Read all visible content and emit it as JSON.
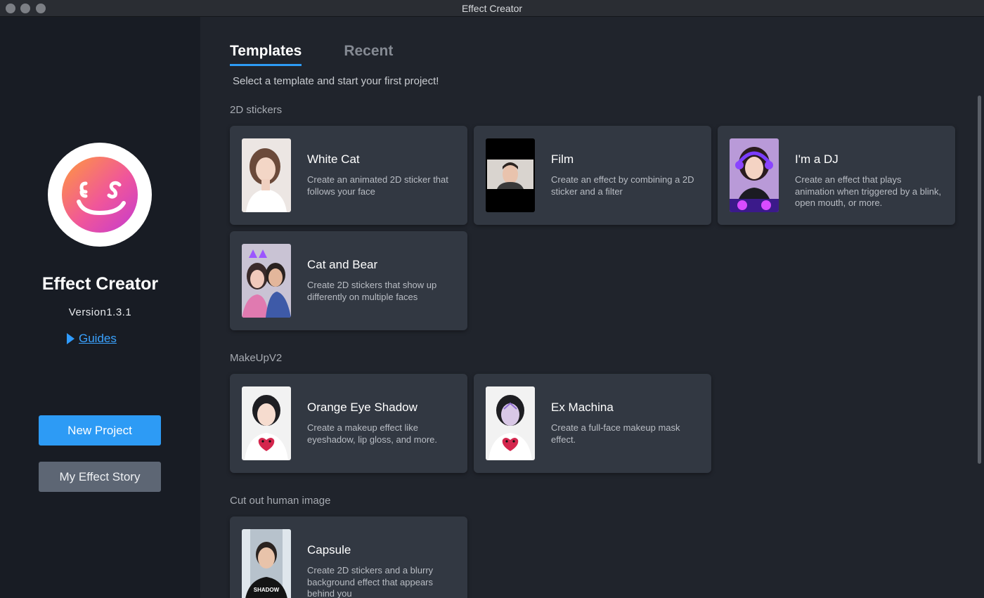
{
  "window": {
    "title": "Effect Creator"
  },
  "sidebar": {
    "app_name": "Effect Creator",
    "version": "Version1.3.1",
    "guides_label": "Guides",
    "new_project_label": "New Project",
    "story_label": "My Effect Story"
  },
  "main": {
    "tabs": [
      {
        "label": "Templates",
        "active": true
      },
      {
        "label": "Recent",
        "active": false
      }
    ],
    "subtitle": "Select a template and start your first project!",
    "sections": [
      {
        "title": "2D stickers"
      },
      {
        "title": "MakeUpV2"
      },
      {
        "title": "Cut out human image"
      }
    ],
    "cards": [
      {
        "title": "White Cat",
        "desc": "Create an animated 2D sticker that follows your face"
      },
      {
        "title": "Film",
        "desc": "Create an effect by combining a 2D sticker and a filter"
      },
      {
        "title": "I'm a DJ",
        "desc": "Create an effect that plays animation when triggered by a blink, open mouth, or more."
      },
      {
        "title": "Cat and Bear",
        "desc": "Create 2D stickers that show up differently on multiple faces"
      },
      {
        "title": "Orange Eye Shadow",
        "desc": "Create a makeup effect like eyeshadow, lip gloss, and more."
      },
      {
        "title": "Ex Machina",
        "desc": "Create a full-face makeup mask effect."
      },
      {
        "title": "Capsule",
        "desc": "Create 2D stickers and a blurry background effect that appears behind you"
      }
    ],
    "capsule_shirt_text": "SHADOW"
  },
  "colors": {
    "accent": "#2d9bf5",
    "sidebar_bg": "#181c24",
    "main_bg": "#20242c",
    "card_bg": "#323842"
  }
}
